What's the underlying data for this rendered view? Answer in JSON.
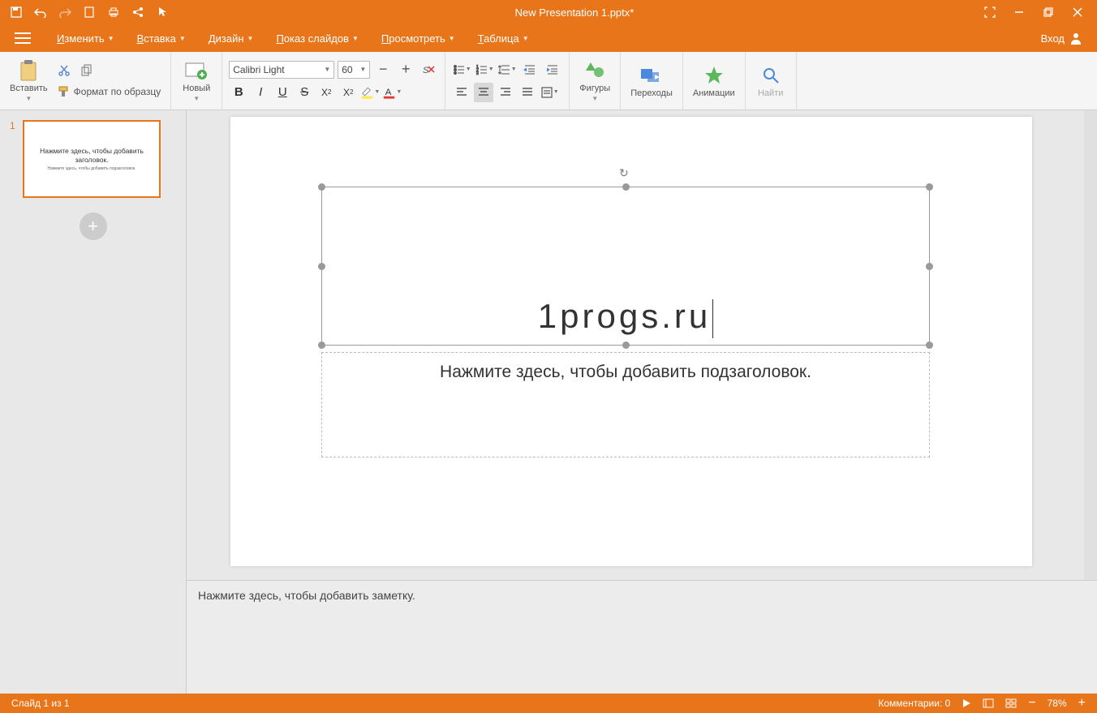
{
  "window": {
    "title": "New Presentation 1.pptx*"
  },
  "menu": {
    "items": [
      {
        "l": "И",
        "rest": "зменить"
      },
      {
        "l": "В",
        "rest": "ставка"
      },
      {
        "l": "Д",
        "rest": "изайн"
      },
      {
        "l": "П",
        "rest": "оказ слайдов"
      },
      {
        "l": "П",
        "rest": "росмотреть"
      },
      {
        "l": "Т",
        "rest": "аблица"
      }
    ],
    "login": "Вход"
  },
  "toolbar": {
    "paste": "Вставить",
    "format_painter": "Формат по образцу",
    "new": "Новый",
    "font_name": "Calibri Light",
    "font_size": "60",
    "shapes": "Фигуры",
    "transitions": "Переходы",
    "animations": "Анимации",
    "find": "Найти"
  },
  "slide": {
    "title_text": "1progs.ru",
    "subtitle_placeholder": "Нажмите здесь, чтобы добавить подзаголовок.",
    "thumb_title": "Нажмите здесь, чтобы добавить заголовок.",
    "thumb_sub": "Нажмите здесь, чтобы добавить подзаголовок.",
    "thumb_num": "1"
  },
  "notes": {
    "placeholder": "Нажмите здесь, чтобы добавить заметку."
  },
  "status": {
    "slide_info": "Слайд 1 из 1",
    "comments": "Комментарии: 0",
    "zoom": "78%"
  },
  "colors": {
    "accent": "#e8751a"
  }
}
